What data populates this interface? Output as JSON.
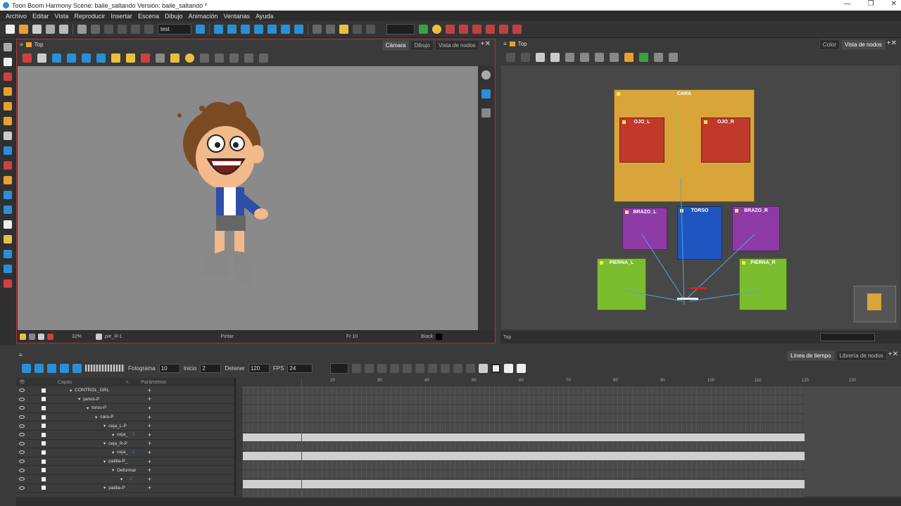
{
  "window": {
    "title": "Toon Boom Harmony Scene: baile_saltando Versión: baile_saltando *"
  },
  "menu": [
    "Archivo",
    "Editar",
    "Vista",
    "Reproducir",
    "Insertar",
    "Escena",
    "Dibujo",
    "Animación",
    "Ventanas",
    "Ayuda"
  ],
  "toolbar": {
    "test_dropdown": "test"
  },
  "camera": {
    "breadcrumb": "Top",
    "tabs": [
      "Cámara",
      "Dibujo",
      "Vista de nodos"
    ],
    "status_zoom": "32%",
    "status_layer": "pie_R-1",
    "status_tool": "Pintar",
    "status_frame": "Fr 10",
    "status_color": "Black"
  },
  "nodeview": {
    "breadcrumb": "Top",
    "tabs": [
      "Color",
      "Vista de nodos"
    ],
    "status": "Top",
    "groups": [
      "CARA",
      "OJO_L",
      "OJO_R",
      "BRAZO_L",
      "TORSO",
      "BRAZO_R",
      "PIERNA_L",
      "PIERNA_R"
    ]
  },
  "timeline": {
    "tabs": [
      "Línea de tiempo",
      "Librería de nodos"
    ],
    "fotograma_label": "Fotograma",
    "fotograma": "10",
    "inicio_label": "Inicio",
    "inicio": "2",
    "detener_label": "Detener",
    "detener": "120",
    "fps_label": "FPS",
    "fps": "24",
    "capas_label": "Capas",
    "parametros_label": "Parámetros",
    "ruler": [
      "20",
      "30",
      "40",
      "50",
      "60",
      "70",
      "80",
      "90",
      "100",
      "110",
      "120",
      "130"
    ],
    "layers": [
      {
        "name": "CONTROL_GRL"
      },
      {
        "name": "pelvis-P"
      },
      {
        "name": "torso-P"
      },
      {
        "name": "cara-P"
      },
      {
        "name": "ceja_L-P"
      },
      {
        "name": "ceja_",
        "extra": "2"
      },
      {
        "name": "ceja_R-P"
      },
      {
        "name": "ceja_",
        "extra": "2"
      },
      {
        "name": "patilla-P_"
      },
      {
        "name": "Deformar"
      },
      {
        "name": "",
        "extra": "2"
      },
      {
        "name": "patilla-P"
      }
    ]
  },
  "colors": {
    "accent_red": "#d02020",
    "cara_group": "#d9a53a",
    "ojo_group": "#c0392b",
    "brazo_group": "#8e3ba8",
    "torso_group": "#1f55c0",
    "pierna_group": "#7cbc2f"
  }
}
